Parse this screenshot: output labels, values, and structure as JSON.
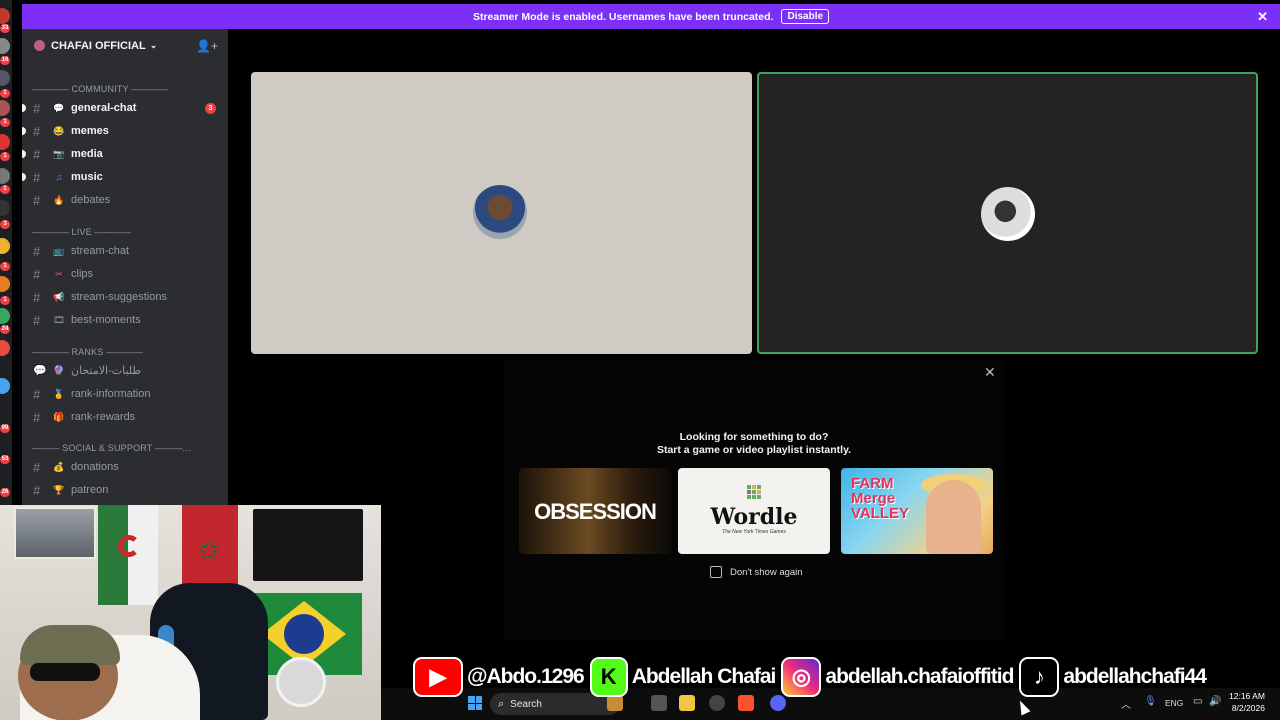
{
  "banner": {
    "message": "Streamer Mode is enabled. Usernames have been truncated.",
    "button": "Disable"
  },
  "rail": {
    "badges": [
      "33",
      "16",
      "1",
      "1",
      "1",
      "1",
      "1",
      "3",
      "1",
      "1",
      "24",
      "1",
      "99",
      "1",
      "3",
      "1",
      "53",
      "26"
    ]
  },
  "server": {
    "name": "CHAFAI OFFICIAL"
  },
  "categories": [
    {
      "label": "———— COMMUNITY ————"
    },
    {
      "label": "———— LIVE ————"
    },
    {
      "label": "———— RANKS ————"
    },
    {
      "label": "——— SOCIAL & SUPPORT ———..."
    }
  ],
  "channels": [
    {
      "name": "general-chat",
      "unread": true,
      "mention": "3",
      "color": "#dbdee1"
    },
    {
      "name": "memes",
      "unread": true,
      "color": "#f0b232"
    },
    {
      "name": "media",
      "unread": true,
      "color": "#5865f2"
    },
    {
      "name": "music",
      "unread": true,
      "color": "#6b7ce6"
    },
    {
      "name": "debates",
      "unread": false,
      "color": "#f26522"
    },
    {
      "name": "stream-chat",
      "unread": false,
      "color": "#4aa3f2"
    },
    {
      "name": "clips",
      "unread": false,
      "color": "#e45a6b"
    },
    {
      "name": "stream-suggestions",
      "unread": false,
      "color": "#e05d9e"
    },
    {
      "name": "best-moments",
      "unread": false,
      "color": "#8e7be6"
    },
    {
      "name": "طلبات-الامتحان",
      "unread": false,
      "color": "#b5bac1"
    },
    {
      "name": "rank-information",
      "unread": false,
      "color": "#f0b232"
    },
    {
      "name": "rank-rewards",
      "unread": false,
      "color": "#e0823c"
    },
    {
      "name": "donations",
      "unread": false,
      "color": "#f0b232"
    },
    {
      "name": "patreon",
      "unread": false,
      "color": "#f0b232"
    }
  ],
  "activity": {
    "line1": "Looking for something to do?",
    "line2": "Start a game or video playlist instantly.",
    "cards": [
      {
        "title": "OBSESSION"
      },
      {
        "title": "Wordle",
        "subtitle": "The New York Times Games"
      },
      {
        "title": "FARM Merge VALLEY"
      }
    ],
    "checkbox_label": "Don't show again"
  },
  "socials": [
    {
      "icon": "youtube-icon",
      "handle": "@Abdo.1296"
    },
    {
      "icon": "kick-icon",
      "handle": "Abdellah Chafai"
    },
    {
      "icon": "instagram-icon",
      "handle": "abdellah.chafaioffitid"
    },
    {
      "icon": "tiktok-icon",
      "handle": "abdellahchafi44"
    }
  ],
  "taskbar": {
    "search_label": "Search",
    "lang": "ENG",
    "time": "12:16 AM",
    "date": "8/2/2026"
  },
  "colors": {
    "banner": "#7b2ff7",
    "speaking_border": "#3ba55d",
    "mention": "#f23f43"
  }
}
